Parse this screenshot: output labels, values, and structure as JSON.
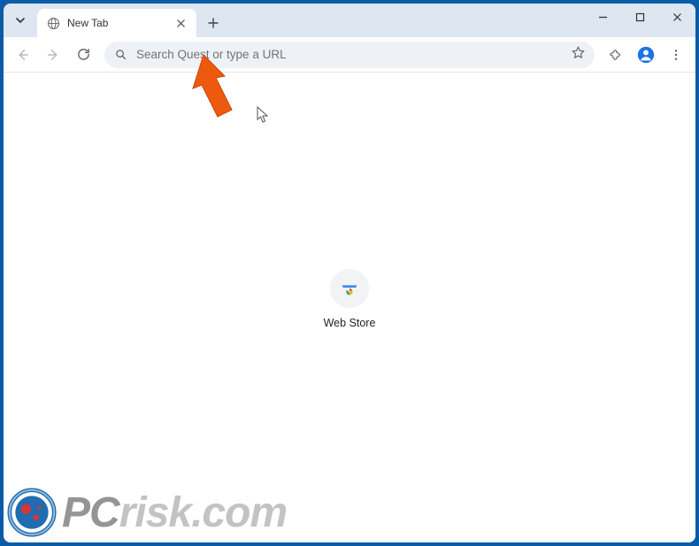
{
  "tab": {
    "title": "New Tab"
  },
  "omnibox": {
    "placeholder": "Search Quest or type a URL",
    "value": ""
  },
  "shortcuts": [
    {
      "label": "Web Store"
    }
  ],
  "watermark": {
    "brand_pc": "PC",
    "brand_rest": "risk.com"
  }
}
